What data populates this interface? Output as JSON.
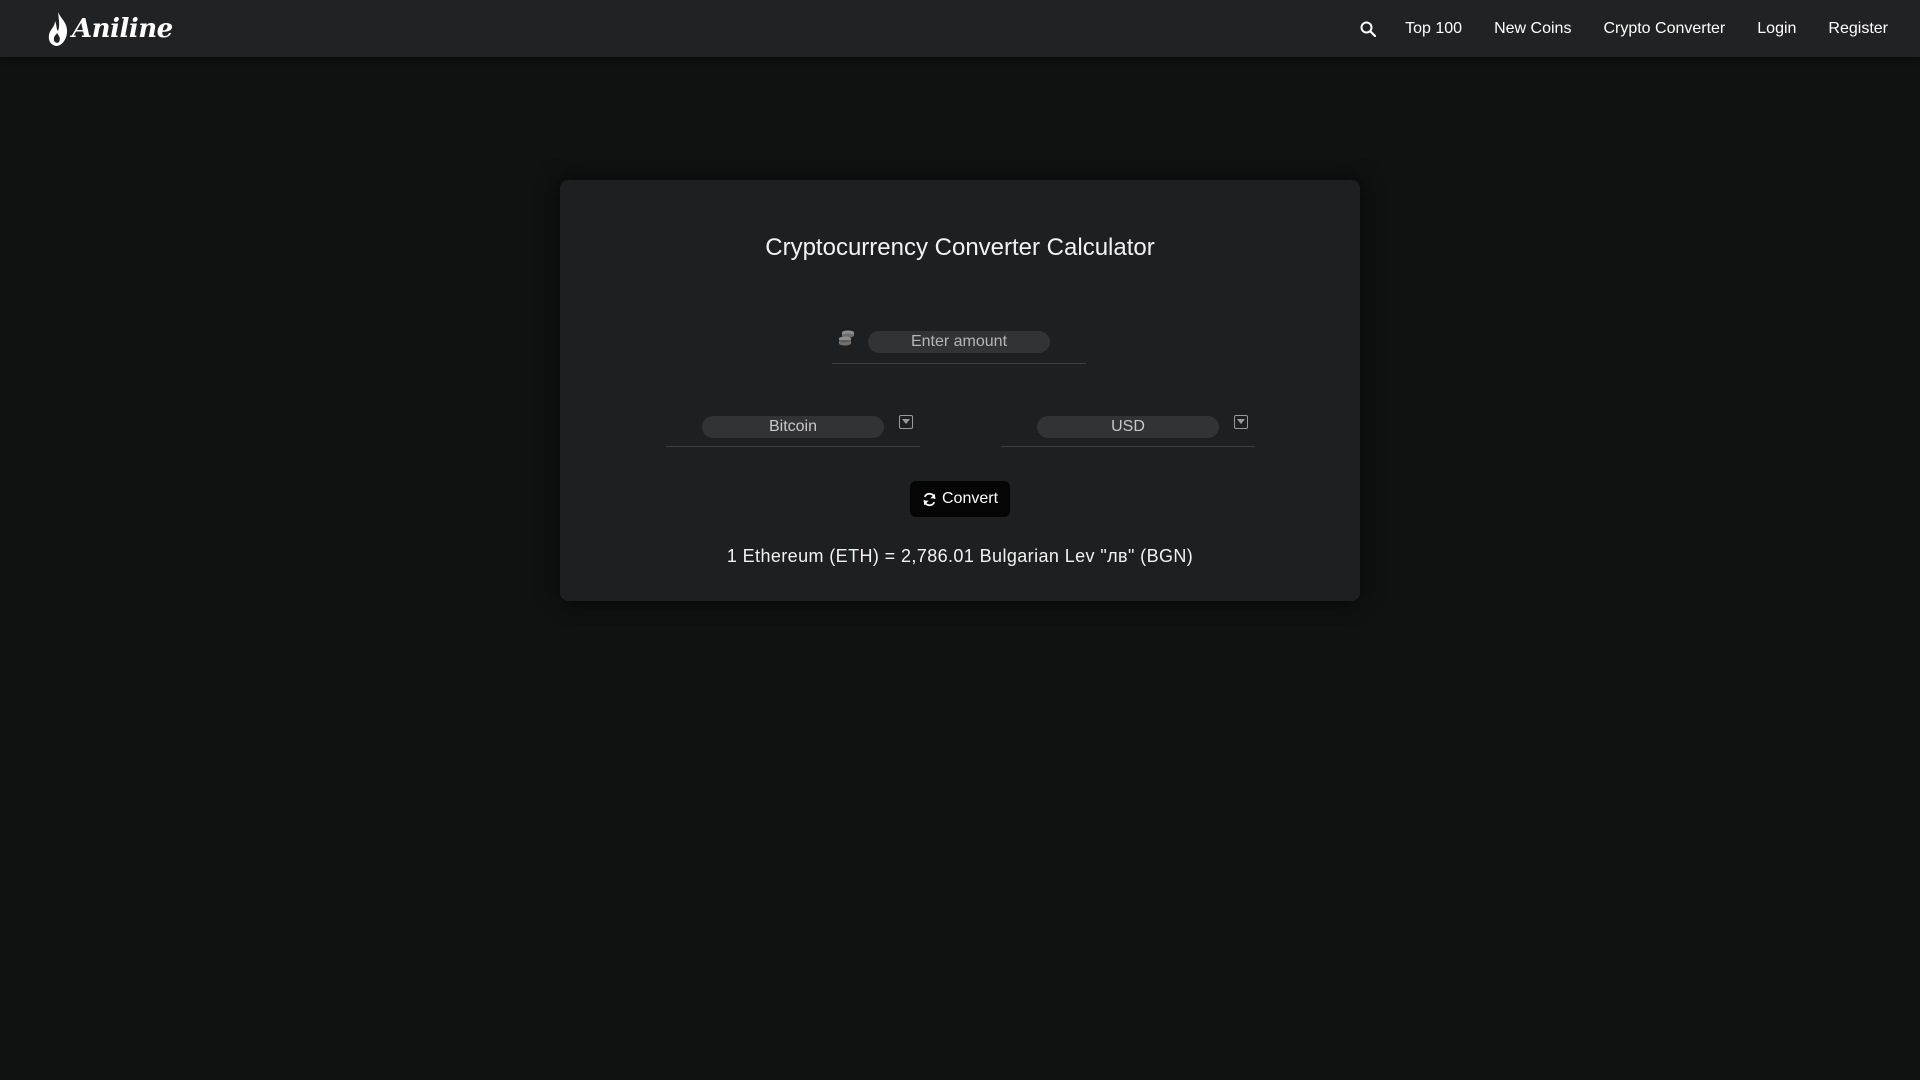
{
  "header": {
    "brand": "Aniline",
    "nav": {
      "top100": "Top 100",
      "new_coins": "New Coins",
      "crypto_converter": "Crypto Converter",
      "login": "Login",
      "register": "Register"
    },
    "icons": {
      "search": "search-icon",
      "logo": "flame-logo-icon"
    }
  },
  "converter": {
    "title": "Cryptocurrency Converter Calculator",
    "amount": {
      "placeholder": "Enter amount",
      "value": "",
      "icon": "coins-icon"
    },
    "from_currency": {
      "selected": "Bitcoin"
    },
    "to_currency": {
      "selected": "USD"
    },
    "convert_label": "Convert",
    "result": "1 Ethereum (ETH) = 2,786.01 Bulgarian Lev \"лв\" (BGN)"
  },
  "colors": {
    "page_background": "#101212",
    "navbar_background": "#212224",
    "card_background": "#1e1f21",
    "field_background": "#323335",
    "button_background": "#050505",
    "text_primary": "#ffffff"
  }
}
